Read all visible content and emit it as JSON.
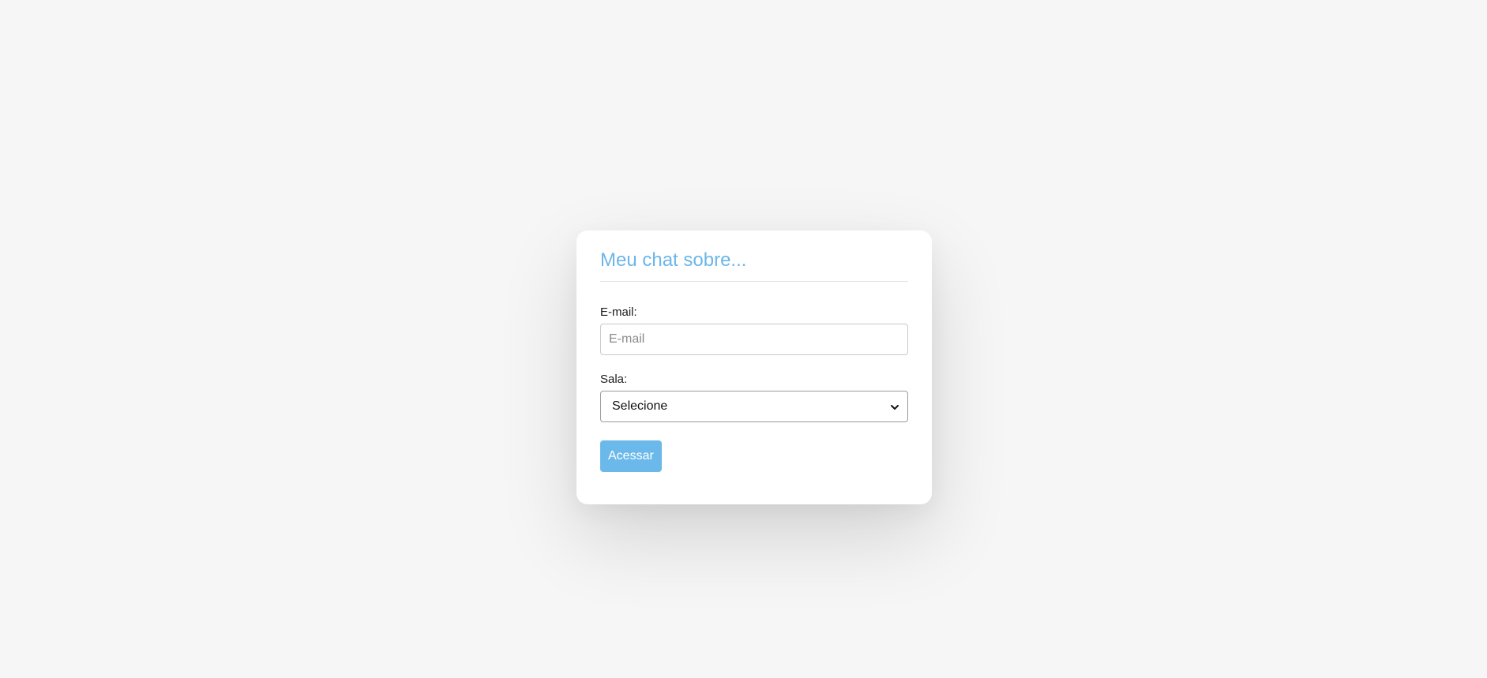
{
  "form": {
    "title": "Meu chat sobre...",
    "email": {
      "label": "E-mail:",
      "placeholder": "E-mail",
      "value": ""
    },
    "room": {
      "label": "Sala:",
      "selected": "Selecione"
    },
    "submit_label": "Acessar"
  },
  "icons": {
    "select_arrow": "chevron-down-icon"
  },
  "colors": {
    "accent": "#6bb9ea",
    "background": "#f6f6f6",
    "card": "#ffffff"
  }
}
